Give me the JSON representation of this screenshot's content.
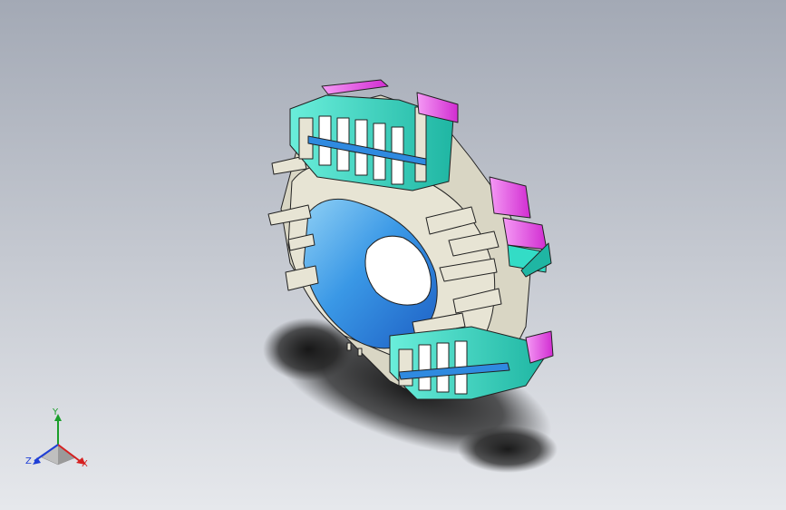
{
  "viewport": {
    "background_top": "#a3a9b5",
    "background_bottom": "#e6e8ec",
    "shadow_color": "#1a1a1a"
  },
  "model": {
    "colors": {
      "body": "#d9d6c4",
      "inner_ring": "#2f8ae0",
      "inner_ring_light": "#7cc2f2",
      "teal": "#33dcc6",
      "teal_dark": "#1ba897",
      "magenta": "#e03ce0",
      "magenta_light": "#f27ef2",
      "hole": "#ffffff",
      "edge": "#222222"
    }
  },
  "axis_triad": {
    "y_label": "Y",
    "z_label": "Z",
    "x_label": "X",
    "colors": {
      "x": "#d62020",
      "y": "#1a9e2a",
      "z": "#1f3fd6"
    }
  }
}
